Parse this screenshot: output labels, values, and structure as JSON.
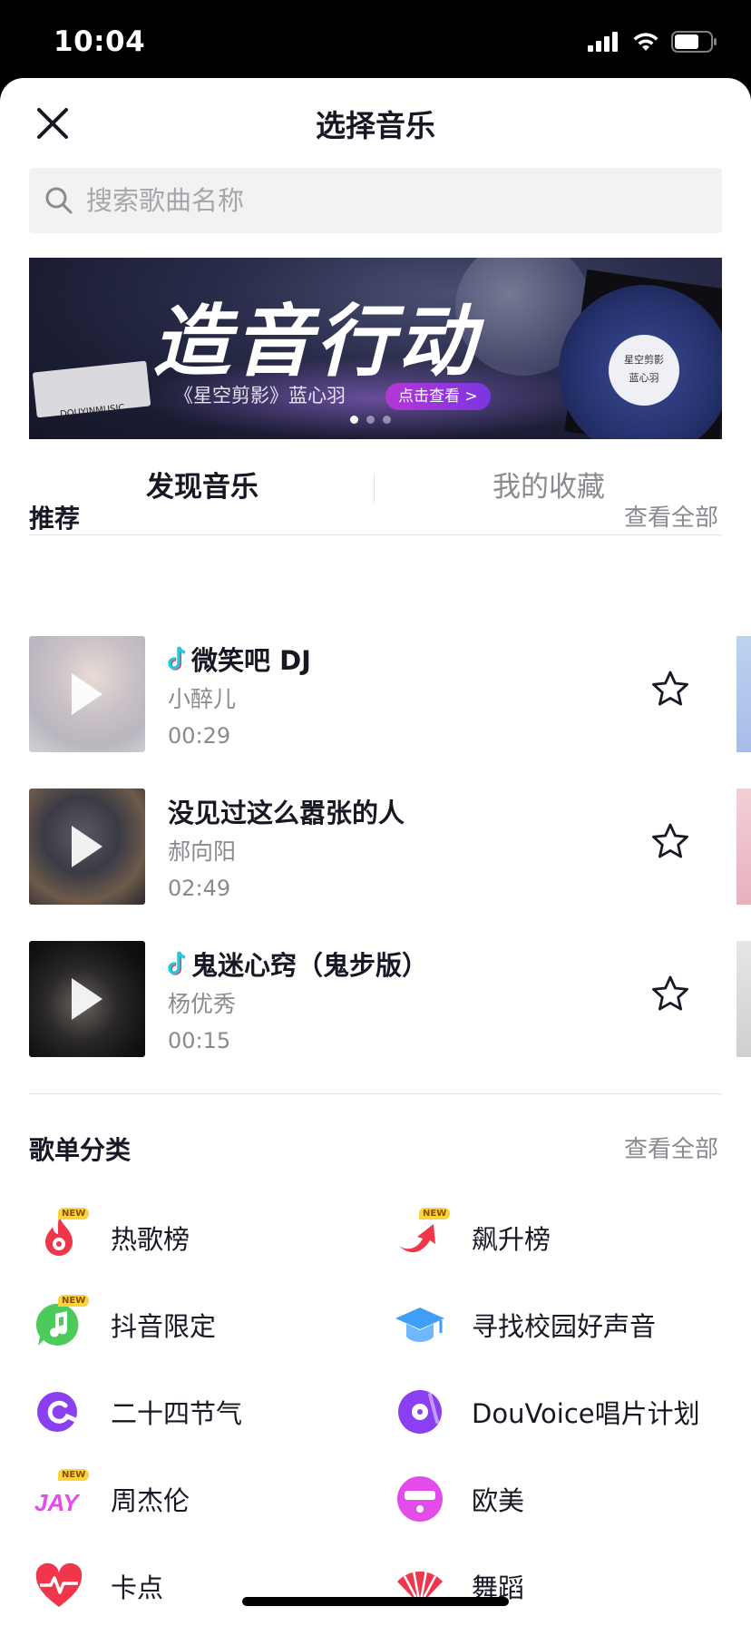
{
  "status_bar": {
    "time": "10:04"
  },
  "header": {
    "title": "选择音乐"
  },
  "search": {
    "placeholder": "搜索歌曲名称"
  },
  "banner": {
    "headline": "造音行动",
    "subtitle": "《星空剪影》蓝心羽",
    "cta": "点击查看 >",
    "tag_text": "DOUYINMUSIC",
    "disc_label_title": "星空剪影",
    "disc_label_artist": "蓝心羽",
    "page_count": 3,
    "active_page": 1
  },
  "tabs": [
    {
      "label": "发现音乐",
      "active": true
    },
    {
      "label": "我的收藏",
      "active": false
    }
  ],
  "recommend": {
    "title": "推荐",
    "see_all": "查看全部",
    "songs": [
      {
        "title": "微笑吧 DJ",
        "artist": "小醉儿",
        "duration": "00:29",
        "douyin_original": true
      },
      {
        "title": "没见过这么嚣张的人",
        "artist": "郝向阳",
        "duration": "02:49",
        "douyin_original": false
      },
      {
        "title": "鬼迷心窍（鬼步版）",
        "artist": "杨优秀",
        "duration": "00:15",
        "douyin_original": true
      }
    ]
  },
  "playlist_categories": {
    "title": "歌单分类",
    "see_all": "查看全部",
    "items": [
      {
        "label": "热歌榜",
        "icon": "fire-icon",
        "new": true,
        "color": "#f0364b"
      },
      {
        "label": "飙升榜",
        "icon": "rising-arrow-icon",
        "new": true,
        "color": "#f0364b"
      },
      {
        "label": "抖音限定",
        "icon": "music-note-bubble-icon",
        "new": true,
        "color": "#4ccb5c"
      },
      {
        "label": "寻找校园好声音",
        "icon": "graduation-cap-icon",
        "new": false,
        "color": "#3f9ef5"
      },
      {
        "label": "二十四节气",
        "icon": "swirl-icon",
        "new": false,
        "color": "#8a3ff0"
      },
      {
        "label": "DouVoice唱片计划",
        "icon": "vinyl-record-icon",
        "new": false,
        "color": "#8a3ff0"
      },
      {
        "label": "周杰伦",
        "icon": "jay-text-icon",
        "new": true,
        "color": "#e34ce8"
      },
      {
        "label": "欧美",
        "icon": "face-sunglasses-icon",
        "new": false,
        "color": "#e34ce8"
      },
      {
        "label": "卡点",
        "icon": "heartbeat-icon",
        "new": false,
        "color": "#f0364b"
      },
      {
        "label": "舞蹈",
        "icon": "fan-icon",
        "new": false,
        "color": "#f0364b"
      }
    ]
  },
  "colors": {
    "primary_text": "#161823",
    "secondary_text": "#8a8b91",
    "douyin_note_cyan": "#25c7e0",
    "douyin_note_red": "#fe2c55"
  }
}
